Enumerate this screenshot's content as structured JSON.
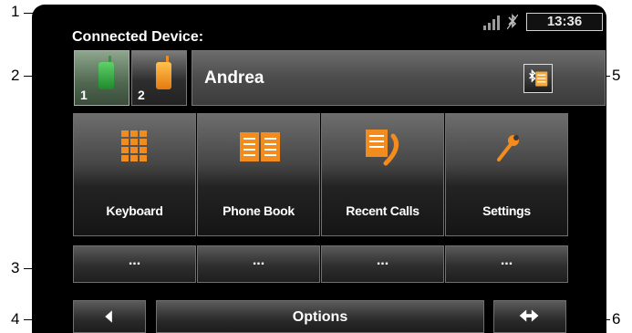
{
  "callouts": [
    "1",
    "2",
    "3",
    "4",
    "5",
    "6"
  ],
  "status_bar": {
    "time": "13:36",
    "signal_icon": "signal-strength-icon",
    "bluetooth_icon": "bluetooth-off-icon"
  },
  "connected_device": {
    "label": "Connected Device:",
    "devices": [
      {
        "number": "1",
        "icon": "green-phone-icon",
        "active": true
      },
      {
        "number": "2",
        "icon": "orange-phone-icon",
        "active": false
      }
    ],
    "name": "Andrea",
    "settings_icon": "bluetooth-list-icon"
  },
  "tiles": [
    {
      "label": "Keyboard",
      "icon": "keypad-icon"
    },
    {
      "label": "Phone Book",
      "icon": "book-icon"
    },
    {
      "label": "Recent Calls",
      "icon": "call-list-icon"
    },
    {
      "label": "Settings",
      "icon": "wrench-icon"
    }
  ],
  "slots": [
    "...",
    "...",
    "...",
    "..."
  ],
  "bottom": {
    "back_icon": "triangle-left-icon",
    "options_label": "Options",
    "switch_icon": "arrows-left-right-icon"
  },
  "colors": {
    "accent": "#f28c1e",
    "active_phone": "#2e9b3a"
  }
}
